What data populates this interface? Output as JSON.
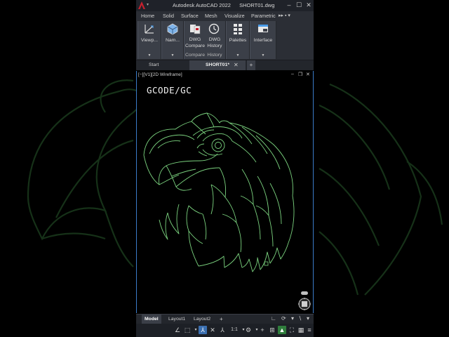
{
  "titlebar": {
    "app_name": "Autodesk AutoCAD 2022",
    "file_name": "SHORT01.dwg"
  },
  "ribbon_tabs": [
    "Home",
    "Solid",
    "Surface",
    "Mesh",
    "Visualize",
    "Parametric"
  ],
  "ribbon_groups": [
    {
      "label": "Viewp..."
    },
    {
      "label": "Nam..."
    },
    {
      "label_line1": "DWG",
      "label_line2": "Compare",
      "footer": "Compare"
    },
    {
      "label_line1": "DWG",
      "label_line2": "History",
      "footer": "History"
    },
    {
      "label": "Palettes"
    },
    {
      "label": "Interface"
    }
  ],
  "doc_tabs": {
    "start": "Start",
    "active": "SHORT01*",
    "close": "✕",
    "add": "+"
  },
  "viewport": {
    "label": "[−][V1][2D Wireframe]",
    "overlay_text": "GCODE/GC",
    "line_color": "#7bd37f"
  },
  "layout_tabs": [
    "Model",
    "Layout1",
    "Layout2",
    "+"
  ],
  "status": {
    "scale": "1:1"
  },
  "colors": {
    "accent_blue": "#3b7cc9",
    "autocad_red": "#c8202e",
    "drawing_green": "#7bd37f"
  }
}
